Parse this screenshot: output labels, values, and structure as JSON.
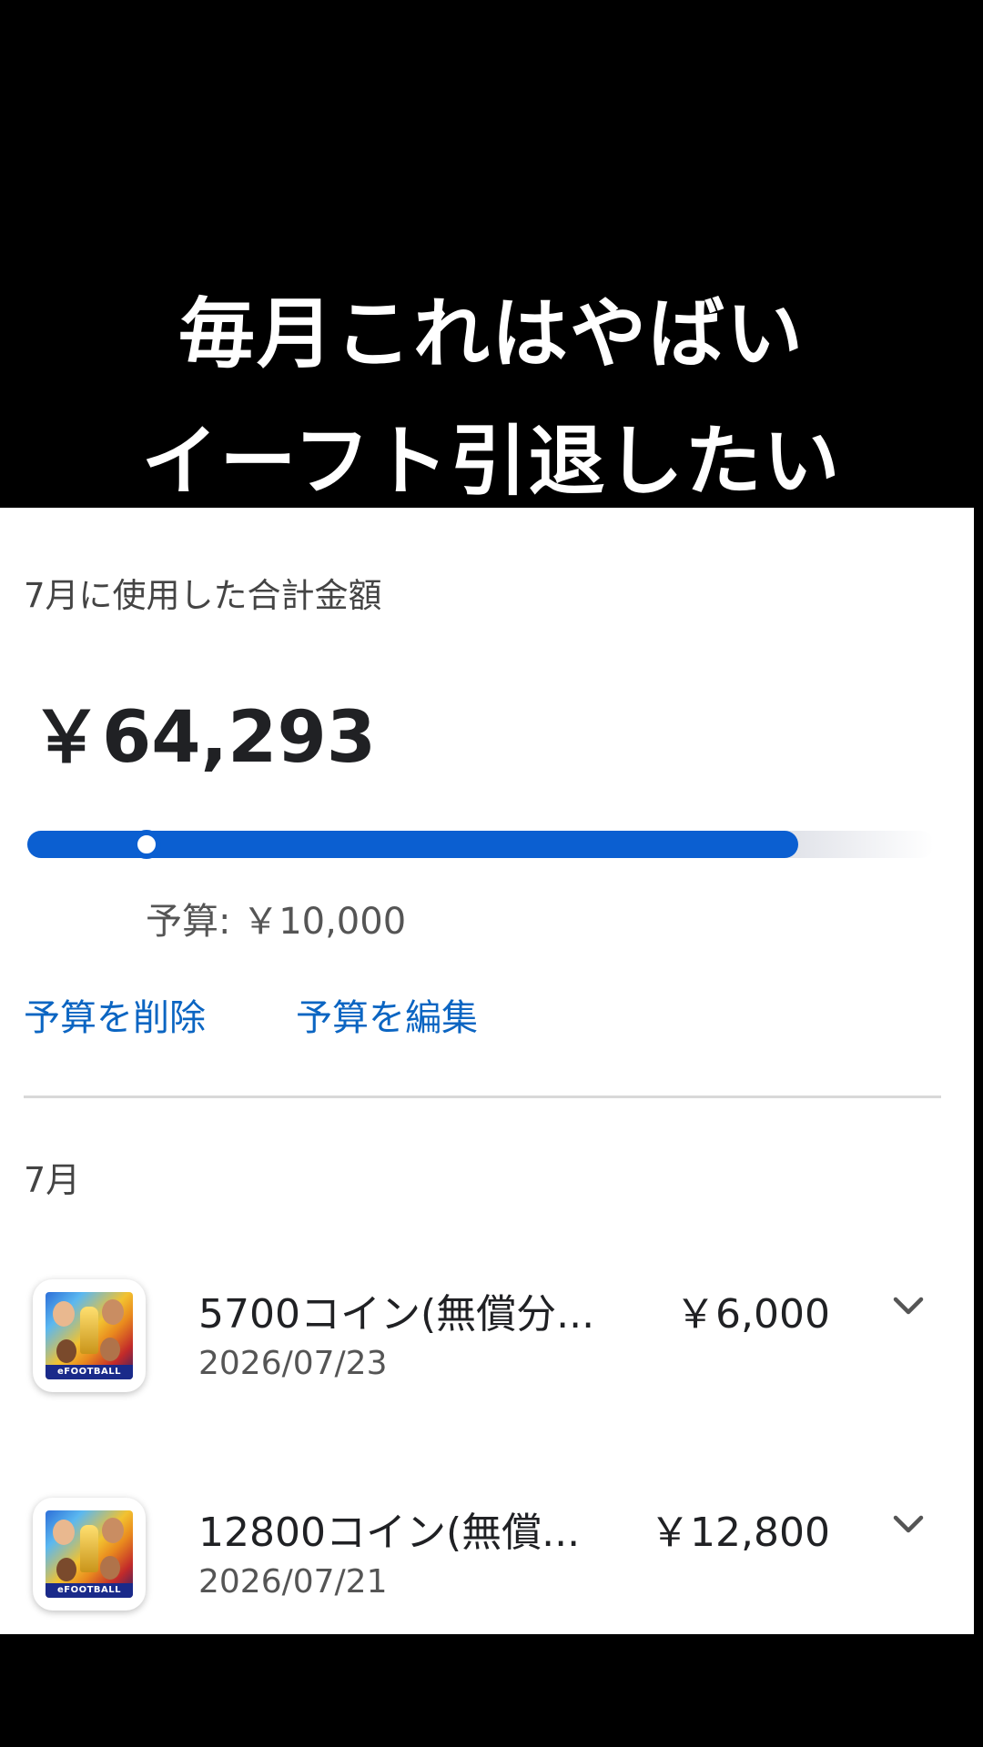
{
  "caption": {
    "line1": "毎月これはやばい",
    "line2": "イーフト引退したい"
  },
  "summary": {
    "total_label": "7月に使用した合計金額",
    "total_amount": "￥64,293",
    "budget_label": "予算: ￥10,000",
    "spend_fraction_of_track": 0.85,
    "budget_fraction_of_track": 0.132,
    "delete_budget": "予算を削除",
    "edit_budget": "予算を編集"
  },
  "colors": {
    "accent": "#0b5fd1",
    "link": "#0b65c2"
  },
  "month_label": "7月",
  "transactions": [
    {
      "icon": "efootball-app-icon",
      "icon_brand": "eFOOTBALL",
      "title": "5700コイン(無償分...",
      "date": "2026/07/23",
      "amount": "￥6,000",
      "expand_icon": "chevron-down-icon"
    },
    {
      "icon": "efootball-app-icon",
      "icon_brand": "eFOOTBALL",
      "title": "12800コイン(無償...",
      "date": "2026/07/21",
      "amount": "￥12,800",
      "expand_icon": "chevron-down-icon"
    }
  ]
}
